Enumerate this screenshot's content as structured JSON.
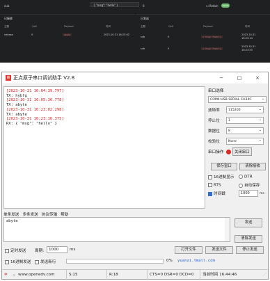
{
  "dashboard": {
    "top_row": {
      "col1": "sub",
      "payload": "{ \"msg\": \"hello\" }",
      "qos": "0",
      "retain_label": "Retain",
      "toggle_label": "Send"
    },
    "left_panel": {
      "title": "已接收",
      "headers": [
        "主题",
        "QoS",
        "Payload",
        "时间"
      ],
      "row": {
        "topic": "release",
        "qos": "0",
        "payload": "abyte",
        "time": "2023-10-31 16:23:02"
      }
    },
    "right_panel": {
      "title": "已发送",
      "headers": [
        "主题",
        "QoS",
        "Payload",
        "时间"
      ],
      "rows": [
        {
          "topic": "sub",
          "qos": "0",
          "payload": "{ \"msg\": \"hello\" }",
          "time": "2023-10-31 16:23:14"
        },
        {
          "topic": "sub",
          "qos": "0",
          "payload": "{ \"msg\": \"hello\" }",
          "time": "2023-10-31 16:23:53"
        }
      ]
    }
  },
  "window": {
    "title": "正点原子串口调试助手 V2.8",
    "minimize": "−",
    "maximize": "□",
    "close": "×"
  },
  "receive_log": [
    {
      "kind": "ts",
      "text": "[2023-10-31 16:04:39.797]"
    },
    {
      "kind": "tx",
      "text": "TX: hybfg"
    },
    {
      "kind": "ts",
      "text": "[2023-10-31 16:05:36.778]"
    },
    {
      "kind": "tx",
      "text": "TX: abyte"
    },
    {
      "kind": "ts",
      "text": "[2023-10-31 16:23:02.298]"
    },
    {
      "kind": "tx",
      "text": "TX: abyte"
    },
    {
      "kind": "ts",
      "text": "[2023-10-31 16:23:16.375]"
    },
    {
      "kind": "tx",
      "text": "RX: { \"msg\": \"hello\" }"
    }
  ],
  "side": {
    "port_label": "串口选择",
    "port_value": "COM4:USB-SERIAL CH34C",
    "baud_label": "波特率",
    "baud_value": "115200",
    "stop_label": "停止位",
    "stop_value": "1",
    "data_label": "数据位",
    "data_value": "8",
    "parity_label": "校验位",
    "parity_value": "None",
    "op_label": "串口操作",
    "op_button": "关闭串口",
    "save_window": "保存窗口",
    "clear_recv": "清除接收",
    "hex_display": "16进制显示",
    "dtr": "DTR",
    "rts": "RTS",
    "auto_save": "自动保存",
    "timestamp": "时间戳",
    "timestamp_value": "1000",
    "ms": "ms"
  },
  "tabs": [
    "单条发送",
    "多条发送",
    "协议传输",
    "帮助"
  ],
  "send_text": "abyte",
  "send_button": "发送",
  "clear_send_button": "清除发送",
  "bottom": {
    "timed_send": "定时发送",
    "period_label": "周期:",
    "period_value": "1000",
    "ms": "ms",
    "open_file": "打开文件",
    "send_file": "发送文件",
    "stop_send": "停止发送",
    "hex_send": "16进制发送",
    "send_newline": "发送新行",
    "progress": "0%",
    "link": "yuanzi.tmall.com"
  },
  "status": {
    "url": "www.openedv.com",
    "s": "S:15",
    "r": "R:18",
    "lines": "CTS=0 DSR=0 DCD=0",
    "time": "当前时间 16:44:46"
  }
}
